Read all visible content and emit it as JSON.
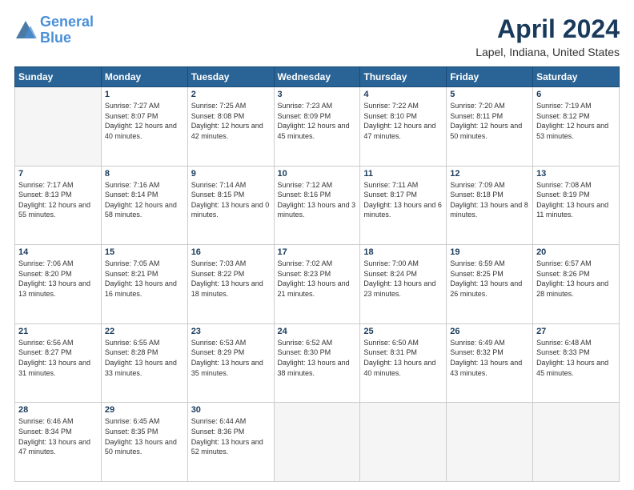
{
  "header": {
    "logo_line1": "General",
    "logo_line2": "Blue",
    "title": "April 2024",
    "subtitle": "Lapel, Indiana, United States"
  },
  "days_of_week": [
    "Sunday",
    "Monday",
    "Tuesday",
    "Wednesday",
    "Thursday",
    "Friday",
    "Saturday"
  ],
  "weeks": [
    [
      {
        "day": "",
        "empty": true
      },
      {
        "day": "1",
        "sunrise": "7:27 AM",
        "sunset": "8:07 PM",
        "daylight": "12 hours and 40 minutes."
      },
      {
        "day": "2",
        "sunrise": "7:25 AM",
        "sunset": "8:08 PM",
        "daylight": "12 hours and 42 minutes."
      },
      {
        "day": "3",
        "sunrise": "7:23 AM",
        "sunset": "8:09 PM",
        "daylight": "12 hours and 45 minutes."
      },
      {
        "day": "4",
        "sunrise": "7:22 AM",
        "sunset": "8:10 PM",
        "daylight": "12 hours and 47 minutes."
      },
      {
        "day": "5",
        "sunrise": "7:20 AM",
        "sunset": "8:11 PM",
        "daylight": "12 hours and 50 minutes."
      },
      {
        "day": "6",
        "sunrise": "7:19 AM",
        "sunset": "8:12 PM",
        "daylight": "12 hours and 53 minutes."
      }
    ],
    [
      {
        "day": "7",
        "sunrise": "7:17 AM",
        "sunset": "8:13 PM",
        "daylight": "12 hours and 55 minutes."
      },
      {
        "day": "8",
        "sunrise": "7:16 AM",
        "sunset": "8:14 PM",
        "daylight": "12 hours and 58 minutes."
      },
      {
        "day": "9",
        "sunrise": "7:14 AM",
        "sunset": "8:15 PM",
        "daylight": "13 hours and 0 minutes."
      },
      {
        "day": "10",
        "sunrise": "7:12 AM",
        "sunset": "8:16 PM",
        "daylight": "13 hours and 3 minutes."
      },
      {
        "day": "11",
        "sunrise": "7:11 AM",
        "sunset": "8:17 PM",
        "daylight": "13 hours and 6 minutes."
      },
      {
        "day": "12",
        "sunrise": "7:09 AM",
        "sunset": "8:18 PM",
        "daylight": "13 hours and 8 minutes."
      },
      {
        "day": "13",
        "sunrise": "7:08 AM",
        "sunset": "8:19 PM",
        "daylight": "13 hours and 11 minutes."
      }
    ],
    [
      {
        "day": "14",
        "sunrise": "7:06 AM",
        "sunset": "8:20 PM",
        "daylight": "13 hours and 13 minutes."
      },
      {
        "day": "15",
        "sunrise": "7:05 AM",
        "sunset": "8:21 PM",
        "daylight": "13 hours and 16 minutes."
      },
      {
        "day": "16",
        "sunrise": "7:03 AM",
        "sunset": "8:22 PM",
        "daylight": "13 hours and 18 minutes."
      },
      {
        "day": "17",
        "sunrise": "7:02 AM",
        "sunset": "8:23 PM",
        "daylight": "13 hours and 21 minutes."
      },
      {
        "day": "18",
        "sunrise": "7:00 AM",
        "sunset": "8:24 PM",
        "daylight": "13 hours and 23 minutes."
      },
      {
        "day": "19",
        "sunrise": "6:59 AM",
        "sunset": "8:25 PM",
        "daylight": "13 hours and 26 minutes."
      },
      {
        "day": "20",
        "sunrise": "6:57 AM",
        "sunset": "8:26 PM",
        "daylight": "13 hours and 28 minutes."
      }
    ],
    [
      {
        "day": "21",
        "sunrise": "6:56 AM",
        "sunset": "8:27 PM",
        "daylight": "13 hours and 31 minutes."
      },
      {
        "day": "22",
        "sunrise": "6:55 AM",
        "sunset": "8:28 PM",
        "daylight": "13 hours and 33 minutes."
      },
      {
        "day": "23",
        "sunrise": "6:53 AM",
        "sunset": "8:29 PM",
        "daylight": "13 hours and 35 minutes."
      },
      {
        "day": "24",
        "sunrise": "6:52 AM",
        "sunset": "8:30 PM",
        "daylight": "13 hours and 38 minutes."
      },
      {
        "day": "25",
        "sunrise": "6:50 AM",
        "sunset": "8:31 PM",
        "daylight": "13 hours and 40 minutes."
      },
      {
        "day": "26",
        "sunrise": "6:49 AM",
        "sunset": "8:32 PM",
        "daylight": "13 hours and 43 minutes."
      },
      {
        "day": "27",
        "sunrise": "6:48 AM",
        "sunset": "8:33 PM",
        "daylight": "13 hours and 45 minutes."
      }
    ],
    [
      {
        "day": "28",
        "sunrise": "6:46 AM",
        "sunset": "8:34 PM",
        "daylight": "13 hours and 47 minutes."
      },
      {
        "day": "29",
        "sunrise": "6:45 AM",
        "sunset": "8:35 PM",
        "daylight": "13 hours and 50 minutes."
      },
      {
        "day": "30",
        "sunrise": "6:44 AM",
        "sunset": "8:36 PM",
        "daylight": "13 hours and 52 minutes."
      },
      {
        "day": "",
        "empty": true
      },
      {
        "day": "",
        "empty": true
      },
      {
        "day": "",
        "empty": true
      },
      {
        "day": "",
        "empty": true
      }
    ]
  ]
}
